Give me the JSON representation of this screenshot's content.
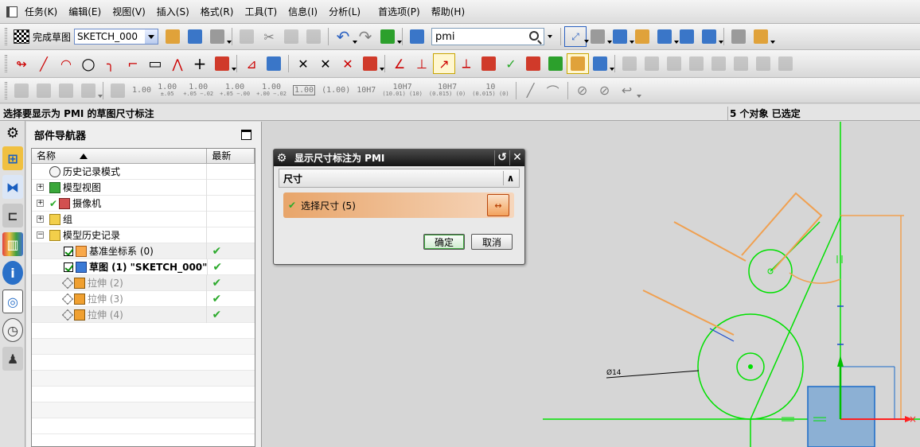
{
  "menubar": {
    "items": [
      "任务(K)",
      "编辑(E)",
      "视图(V)",
      "插入(S)",
      "格式(R)",
      "工具(T)",
      "信息(I)",
      "分析(L)",
      "首选项(P)",
      "帮助(H)"
    ]
  },
  "toolbar1": {
    "finish_sketch_label": "完成草图",
    "sketch_name": "SKETCH_000",
    "search_value": "pmi"
  },
  "toolbar3": {
    "tolerances": [
      {
        "main": "1.00",
        "sub": ""
      },
      {
        "main": "1.00",
        "sub": "±.05"
      },
      {
        "main": "1.00",
        "sub": "+.05 −.02"
      },
      {
        "main": "1.00",
        "sub": "+.05 −.00"
      },
      {
        "main": "1.00",
        "sub": "+.00 −.02"
      },
      {
        "main": "1.00",
        "sub": ""
      },
      {
        "main": "(1.00)",
        "sub": ""
      },
      {
        "main": "10H7",
        "sub": ""
      },
      {
        "main": "10H7",
        "sub": "(10.01) (10)"
      },
      {
        "main": "10H7",
        "sub": "(0.015) (0)"
      },
      {
        "main": "10",
        "sub": "(0.015) (0)"
      }
    ]
  },
  "status": {
    "prompt": "选择要显示为 PMI 的草图尺寸标注",
    "selection": "5 个对象 已选定"
  },
  "navigator": {
    "title": "部件导航器",
    "col_name": "名称",
    "col_latest": "最新",
    "rows": [
      {
        "label": "历史记录模式",
        "latest": ""
      },
      {
        "label": "模型视图",
        "latest": ""
      },
      {
        "label": "摄像机",
        "latest": ""
      },
      {
        "label": "组",
        "latest": ""
      },
      {
        "label": "模型历史记录",
        "latest": ""
      },
      {
        "label": "基准坐标系 (0)",
        "latest": "✔"
      },
      {
        "label": "草图 (1) \"SKETCH_000\"",
        "latest": "✔"
      },
      {
        "label": "拉伸 (2)",
        "latest": "✔"
      },
      {
        "label": "拉伸 (3)",
        "latest": "✔"
      },
      {
        "label": "拉伸 (4)",
        "latest": "✔"
      }
    ]
  },
  "dialog": {
    "title": "显示尺寸标注为 PMI",
    "section": "尺寸",
    "select_label": "选择尺寸 (5)",
    "ok": "确定",
    "cancel": "取消"
  },
  "canvas": {
    "dim_label": "Ø14",
    "colors": {
      "sketch": "#00e000",
      "dimension": "#f0a050",
      "axis_red": "#ff2020",
      "body": "#8cb0d4"
    }
  }
}
